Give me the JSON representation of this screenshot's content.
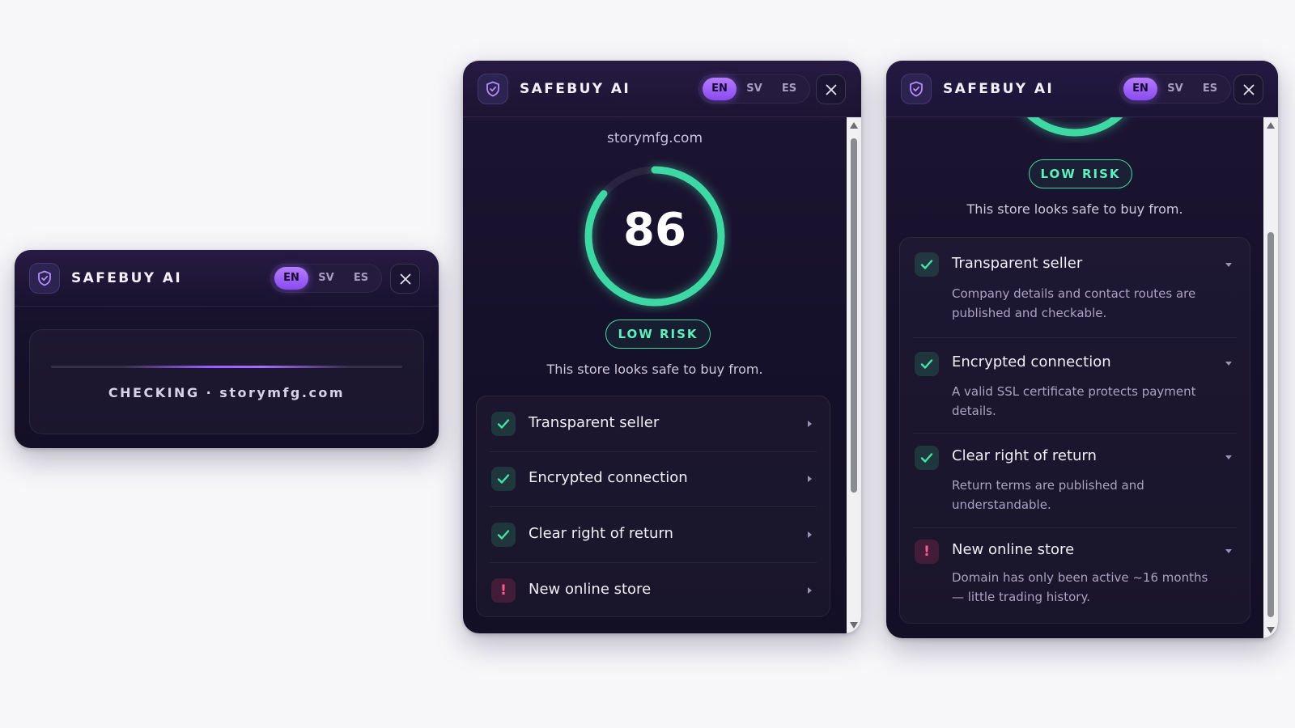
{
  "brand": "SAFEBUY AI",
  "languages": [
    "EN",
    "SV",
    "ES"
  ],
  "active_language": "EN",
  "loading": {
    "status_text": "CHECKING · storymfg.com"
  },
  "result": {
    "domain": "storymfg.com",
    "score": 86,
    "score_max": 100,
    "risk_label": "LOW RISK",
    "summary": "This store looks safe to buy from.",
    "checks": [
      {
        "title": "Transparent seller",
        "status": "pass",
        "icon": "check-icon",
        "description": "Company details and contact routes are published and checkable."
      },
      {
        "title": "Encrypted connection",
        "status": "pass",
        "icon": "check-icon",
        "description": "A valid SSL certificate protects payment details."
      },
      {
        "title": "Clear right of return",
        "status": "pass",
        "icon": "check-icon",
        "description": "Return terms are published and understandable."
      },
      {
        "title": "New online store",
        "status": "warn",
        "icon": "exclamation-icon",
        "warn_symbol": "!",
        "description": "Domain has only been active ~16 months — little trading history."
      }
    ]
  },
  "colors": {
    "accent": "#9b5cff",
    "good": "#3ed8a4",
    "warning": "#ff5d8c",
    "panel_bg": "#16112b"
  }
}
